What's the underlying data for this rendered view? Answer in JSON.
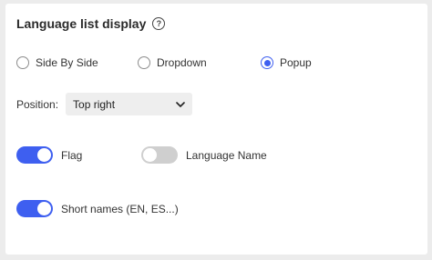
{
  "section": {
    "title": "Language list display",
    "help_icon": "help-circle-icon",
    "help_glyph": "?"
  },
  "display_modes": {
    "selected": "Popup",
    "options": [
      {
        "label": "Side By Side",
        "checked": false
      },
      {
        "label": "Dropdown",
        "checked": false
      },
      {
        "label": "Popup",
        "checked": true
      }
    ]
  },
  "position": {
    "label": "Position:",
    "value": "Top right",
    "icon": "chevron-down-icon"
  },
  "toggles": {
    "flag": {
      "label": "Flag",
      "on": true
    },
    "language_name": {
      "label": "Language Name",
      "on": false
    },
    "short_names": {
      "label": "Short names (EN, ES...)",
      "on": true
    }
  },
  "colors": {
    "accent": "#3e5ff0",
    "toggle_off": "#cfcfcf",
    "card_bg": "#ffffff",
    "page_bg": "#ececec"
  }
}
